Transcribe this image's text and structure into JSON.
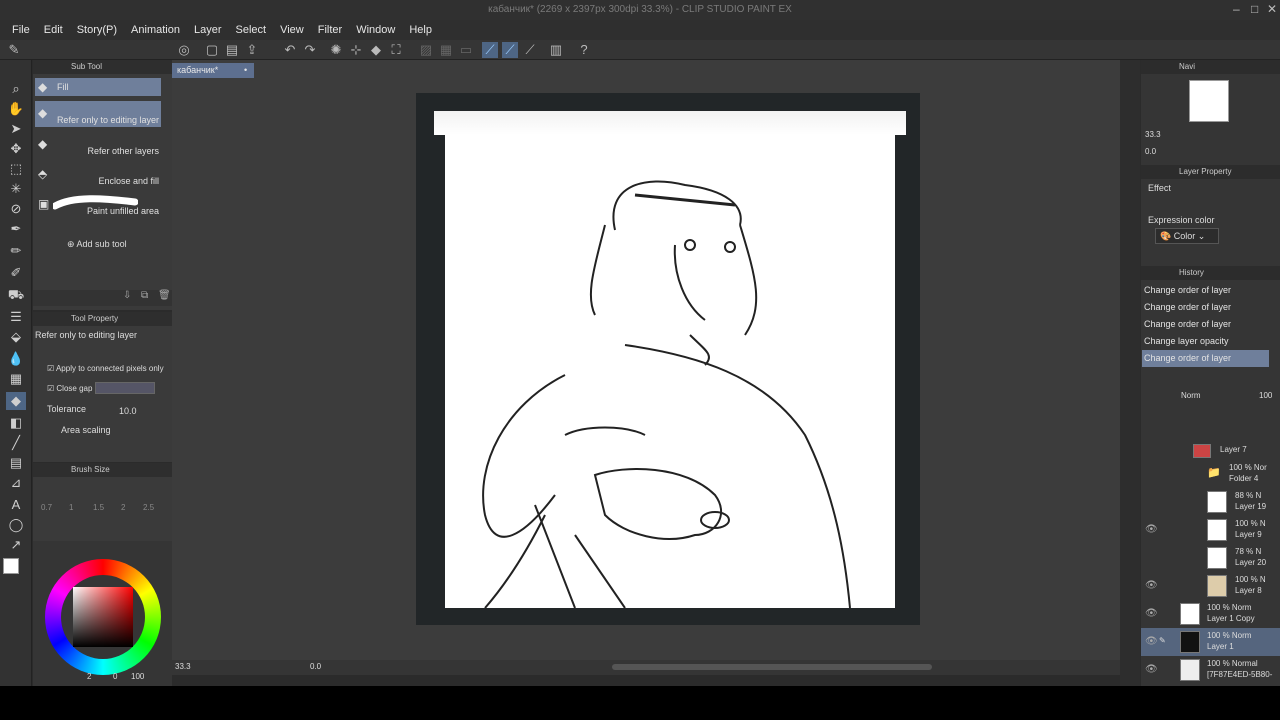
{
  "window": {
    "title": "кабанчик* (2269 x 2397px 300dpi 33.3%) - CLIP STUDIO PAINT EX"
  },
  "menu": [
    "File",
    "Edit",
    "Story(P)",
    "Animation",
    "Layer",
    "Select",
    "View",
    "Filter",
    "Window",
    "Help"
  ],
  "subtool": {
    "header": "Sub Tool",
    "items": [
      {
        "label": "Fill",
        "selected": true
      },
      {
        "label": "Refer only to editing layer",
        "selected": true
      },
      {
        "label": "Refer other layers",
        "selected": false
      },
      {
        "label": "Enclose and fill",
        "selected": false
      },
      {
        "label": "Paint unfilled area",
        "selected": false
      }
    ],
    "add": "Add sub tool"
  },
  "toolprop": {
    "header": "Tool Property",
    "name": "Refer only to editing layer",
    "connected": "Apply to connected pixels only",
    "closegap": "Close gap",
    "tolerance_label": "Tolerance",
    "tolerance_value": "10.0",
    "area_scaling": "Area scaling"
  },
  "brushsize": {
    "header": "Brush Size",
    "values": [
      "0.7",
      "1",
      "1.5",
      "2",
      "2.5"
    ]
  },
  "color": {
    "readout": "2",
    "r": "0",
    "g": "100"
  },
  "document": {
    "tab": "кабанчик*"
  },
  "bottombar": {
    "zoom": "33.3",
    "angle": "0.0"
  },
  "navigator": {
    "header": "Navi",
    "zoom": "33.3",
    "angle": "0.0"
  },
  "layerprop": {
    "header": "Layer Property",
    "effect": "Effect",
    "expression": "Expression color",
    "color": "Color"
  },
  "history": {
    "header": "History",
    "items": [
      {
        "label": "Change order of layer",
        "selected": false
      },
      {
        "label": "Change order of layer",
        "selected": false
      },
      {
        "label": "Change order of layer",
        "selected": false
      },
      {
        "label": "Change layer opacity",
        "selected": false
      },
      {
        "label": "Change order of layer",
        "selected": true
      }
    ]
  },
  "layers": {
    "blend": "Norm",
    "opacity": "100",
    "items": [
      {
        "top": "",
        "name": "Layer 7",
        "thumb": "#c44"
      },
      {
        "top": "100 % Nor",
        "name": "Folder 4",
        "thumb": "folder"
      },
      {
        "top": "88 % N",
        "name": "Layer 19",
        "thumb": "#fff"
      },
      {
        "top": "100 % N",
        "name": "Layer 9",
        "thumb": "#fff"
      },
      {
        "top": "78 % N",
        "name": "Layer 20",
        "thumb": "#fff"
      },
      {
        "top": "100 % N",
        "name": "Layer 8",
        "thumb": "#dca"
      },
      {
        "top": "100 % Norm",
        "name": "Layer 1 Copy",
        "thumb": "#fff"
      },
      {
        "top": "100 % Norm",
        "name": "Layer 1",
        "thumb": "#111"
      },
      {
        "top": "100 % Normal",
        "name": "[7F87E4ED-5B80-",
        "thumb": "#eee"
      }
    ]
  }
}
